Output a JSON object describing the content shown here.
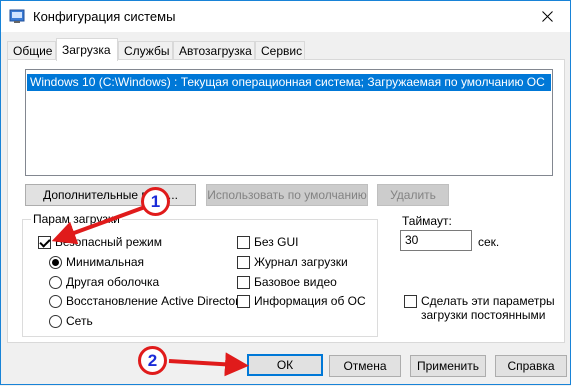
{
  "window": {
    "title": "Конфигурация системы",
    "icon": "msconfig-icon",
    "close_label": "✕"
  },
  "tabs": [
    {
      "label": "Общие",
      "active": false
    },
    {
      "label": "Загрузка",
      "active": true
    },
    {
      "label": "Службы",
      "active": false
    },
    {
      "label": "Автозагрузка",
      "active": false
    },
    {
      "label": "Сервис",
      "active": false
    }
  ],
  "os_list": {
    "entries": [
      "Windows 10 (C:\\Windows) : Текущая операционная система; Загружаемая по умолчанию ОС"
    ]
  },
  "buttons_row": {
    "advanced": "Дополнительные пара...",
    "set_default": "Использовать по умолчанию",
    "delete": "Удалить"
  },
  "boot_options": {
    "legend": "Парам              загрузки",
    "safe_boot": {
      "label": "Безопасный режим",
      "checked": true
    },
    "radios": [
      {
        "label": "Минимальная",
        "selected": true
      },
      {
        "label": "Другая оболочка",
        "selected": false
      },
      {
        "label": "Восстановление Active Directory",
        "selected": false
      },
      {
        "label": "Сеть",
        "selected": false
      }
    ],
    "right_checks": [
      {
        "label": "Без GUI",
        "checked": false
      },
      {
        "label": "Журнал загрузки",
        "checked": false
      },
      {
        "label": "Базовое видео",
        "checked": false
      },
      {
        "label": "Информация  об ОС",
        "checked": false
      }
    ]
  },
  "timeout": {
    "label": "Таймаут:",
    "value": "30",
    "unit": "сек."
  },
  "make_permanent": {
    "label_line1": "Сделать эти параметры",
    "label_line2": "загрузки постоянными",
    "checked": false
  },
  "footer": {
    "ok": "ОК",
    "cancel": "Отмена",
    "apply": "Применить",
    "help": "Справка"
  },
  "annotations": {
    "badge1": "1",
    "badge2": "2",
    "color": "#e01b1b"
  }
}
